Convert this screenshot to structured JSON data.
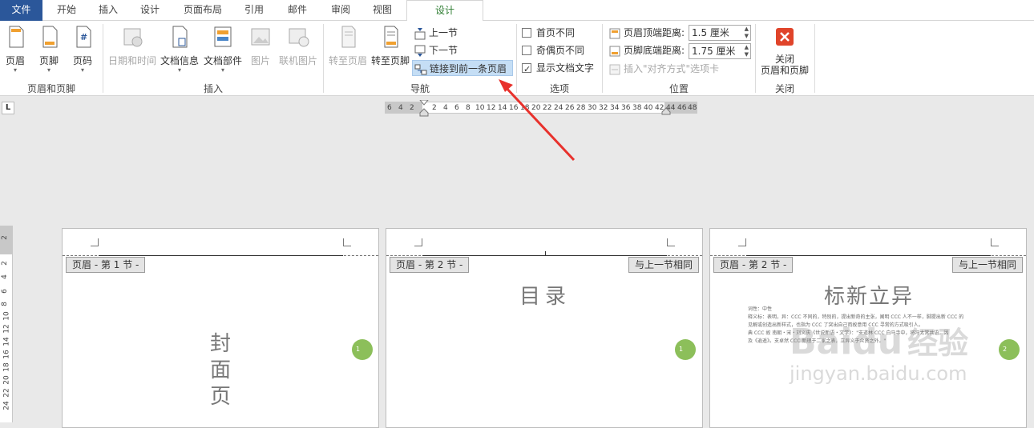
{
  "tabs": [
    {
      "label": "文件"
    },
    {
      "label": "开始"
    },
    {
      "label": "插入"
    },
    {
      "label": "设计"
    },
    {
      "label": "页面布局"
    },
    {
      "label": "引用"
    },
    {
      "label": "邮件"
    },
    {
      "label": "审阅"
    },
    {
      "label": "视图"
    },
    {
      "label": "设计"
    }
  ],
  "ribbon": {
    "header_footer_group": {
      "label": "页眉和页脚",
      "header": "页眉",
      "footer": "页脚",
      "page_number": "页码"
    },
    "insert_group": {
      "label": "插入",
      "datetime": "日期和时间",
      "docinfo": "文档信息",
      "quickparts": "文档部件",
      "picture": "图片",
      "online_picture": "联机图片"
    },
    "nav_group": {
      "label": "导航",
      "goto_header": "转至页眉",
      "goto_footer": "转至页脚",
      "prev_section": "上一节",
      "next_section": "下一节",
      "link_previous": "链接到前一条页眉"
    },
    "options_group": {
      "label": "选项",
      "diff_first": "首页不同",
      "diff_odd_even": "奇偶页不同",
      "show_doc_text": "显示文档文字"
    },
    "position_group": {
      "label": "位置",
      "header_top": "页眉顶端距离:",
      "header_top_value": "1.5 厘米",
      "footer_bottom": "页脚底端距离:",
      "footer_bottom_value": "1.75 厘米",
      "insert_align_tab": "插入\"对齐方式\"选项卡"
    },
    "close_group": {
      "label": "关闭",
      "close_line1": "关闭",
      "close_line2": "页眉和页脚"
    }
  },
  "ruler": {
    "corner": "L",
    "h_left": [
      "6",
      "4",
      "2"
    ],
    "h_main": [
      "2",
      "4",
      "6",
      "8",
      "10",
      "12",
      "14",
      "16",
      "18",
      "20",
      "22",
      "24",
      "26",
      "28",
      "30",
      "32",
      "34",
      "36",
      "38",
      "40",
      "42",
      "44",
      "46",
      "48"
    ],
    "v_top": "2",
    "v_main": [
      "2",
      "4",
      "6",
      "8",
      "10",
      "12",
      "14",
      "16",
      "18",
      "20",
      "22",
      "24"
    ]
  },
  "pages": [
    {
      "header_tag": "页眉 - 第 1 节 -",
      "same_as_prev": "",
      "title": "封面页",
      "circle": "1"
    },
    {
      "header_tag": "页眉 - 第 2 节 -",
      "same_as_prev": "与上一节相同",
      "title": "目录",
      "circle": "1"
    },
    {
      "header_tag": "页眉 - 第 2 节 -",
      "same_as_prev": "与上一节相同",
      "title": "标新立异",
      "circle": "2",
      "body": [
        "词性：中性",
        "释义标：表明，异：CCC 不同的，特别的，提出新奇的主张，阐明 CCC 人不一样，脚提出新 CCC 的",
        "见解或创造出新样式，也指为 CCC 了突出自己而故意用 CCC 寻常的方式吸引人。",
        "典 CCC 故 南朝・宋・刘义庆《世说新语・文学》：\"支道林 CCC 白马寺中，将冯太常共语，因",
        "及《逍遥》。支卓然 CCC 新理于二家之表，立异义于众贤之外。\""
      ]
    }
  ],
  "watermark": {
    "brand": "Baidu",
    "cn": "经验",
    "url": "jingyan.baidu.com"
  },
  "colors": {
    "file_tab": "#2b579a",
    "active_tab_text": "#2e7d32",
    "highlight": "#c5def5",
    "circle": "#8cbf5a",
    "arrow": "#e8312c"
  }
}
